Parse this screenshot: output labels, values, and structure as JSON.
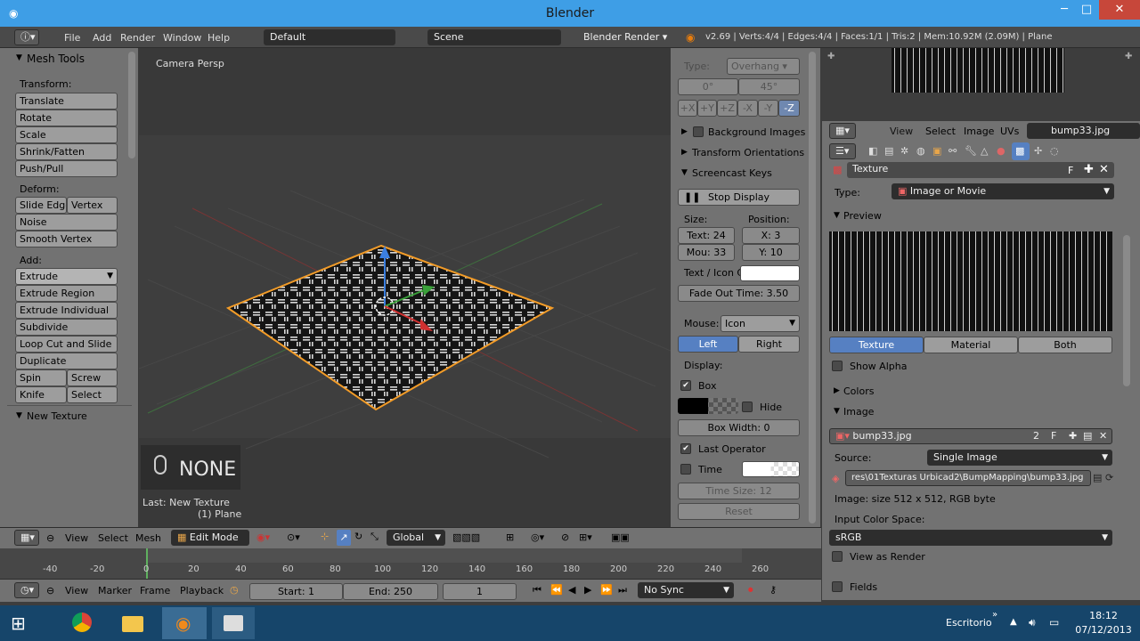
{
  "window": {
    "title": "Blender",
    "minimize": "─",
    "maximize": "□",
    "close": "✕"
  },
  "infobar": {
    "menus": [
      "File",
      "Add",
      "Render",
      "Window",
      "Help"
    ],
    "layout": "Default",
    "scene": "Scene",
    "engine": "Blender Render",
    "stats": "v2.69 | Verts:4/4 | Edges:4/4 | Faces:1/1 | Tris:2 | Mem:10.92M (2.09M) | Plane"
  },
  "toolshelf": {
    "header": "Mesh Tools",
    "transform_label": "Transform:",
    "transform": [
      "Translate",
      "Rotate",
      "Scale",
      "Shrink/Fatten",
      "Push/Pull"
    ],
    "deform_label": "Deform:",
    "slide_edge": "Slide Edge",
    "vertex": "Vertex",
    "noise": "Noise",
    "smooth_vertex": "Smooth Vertex",
    "add_label": "Add:",
    "extrude": "Extrude",
    "add": [
      "Extrude Region",
      "Extrude Individual",
      "Subdivide",
      "Loop Cut and Slide",
      "Duplicate"
    ],
    "spin": "Spin",
    "screw": "Screw",
    "knife": "Knife",
    "select": "Select",
    "new_texture": "New Texture"
  },
  "viewport": {
    "view_name": "Camera Persp",
    "key_display": "NONE",
    "last_op": "Last: New Texture",
    "object": "(1) Plane"
  },
  "props": {
    "type_label": "Type:",
    "type_value": "Overhang",
    "angle_min": "0°",
    "angle_max": "45°",
    "axes": [
      "+X",
      "+Y",
      "+Z",
      "-X",
      "-Y",
      "-Z"
    ],
    "background_images": "Background Images",
    "transform_orientations": "Transform Orientations",
    "screencast_keys": "Screencast Keys",
    "stop_display": "Stop Display",
    "size_label": "Size:",
    "position_label": "Position:",
    "text_size": "Text: 24",
    "pos_x": "X: 3",
    "mouse_size": "Mou: 33",
    "pos_y": "Y: 10",
    "text_icon_color": "Text / Icon C",
    "fade_out": "Fade Out Time: 3.50",
    "mouse_label": "Mouse:",
    "mouse_value": "Icon",
    "left": "Left",
    "right": "Right",
    "display_label": "Display:",
    "box": "Box",
    "hide": "Hide",
    "box_width": "Box Width: 0",
    "last_operator": "Last Operator",
    "time": "Time",
    "time_size": "Time Size: 12",
    "reset": "Reset"
  },
  "uv": {
    "menus": [
      "View",
      "Select",
      "Image",
      "UVs"
    ],
    "image": "bump33.jpg"
  },
  "texture": {
    "context_name": "Texture",
    "fake": "F",
    "type_label": "Type:",
    "type_value": "Image or Movie",
    "preview_label": "Preview",
    "tabs": [
      "Texture",
      "Material",
      "Both"
    ],
    "show_alpha": "Show Alpha",
    "colors_label": "Colors",
    "image_label": "Image",
    "image_name": "bump33.jpg",
    "users": "2",
    "source_label": "Source:",
    "source_value": "Single Image",
    "filepath": "res\\01Texturas Urbicad2\\BumpMapping\\bump33.jpg",
    "image_info": "Image: size 512 x 512, RGB byte",
    "input_color_label": "Input Color Space:",
    "color_space": "sRGB",
    "view_as_render": "View as Render",
    "fields": "Fields"
  },
  "viewheader": {
    "menus": [
      "View",
      "Select",
      "Mesh"
    ],
    "mode": "Edit Mode",
    "orientation": "Global"
  },
  "timeline": {
    "ticks": [
      "-40",
      "-20",
      "0",
      "20",
      "40",
      "60",
      "80",
      "100",
      "120",
      "140",
      "160",
      "180",
      "200",
      "220",
      "240",
      "260"
    ],
    "menus": [
      "View",
      "Marker",
      "Frame",
      "Playback"
    ],
    "start": "Start: 1",
    "end": "End: 250",
    "current": "1",
    "sync": "No Sync"
  },
  "taskbar": {
    "location": "Escritorio",
    "time": "18:12",
    "date": "07/12/2013"
  }
}
